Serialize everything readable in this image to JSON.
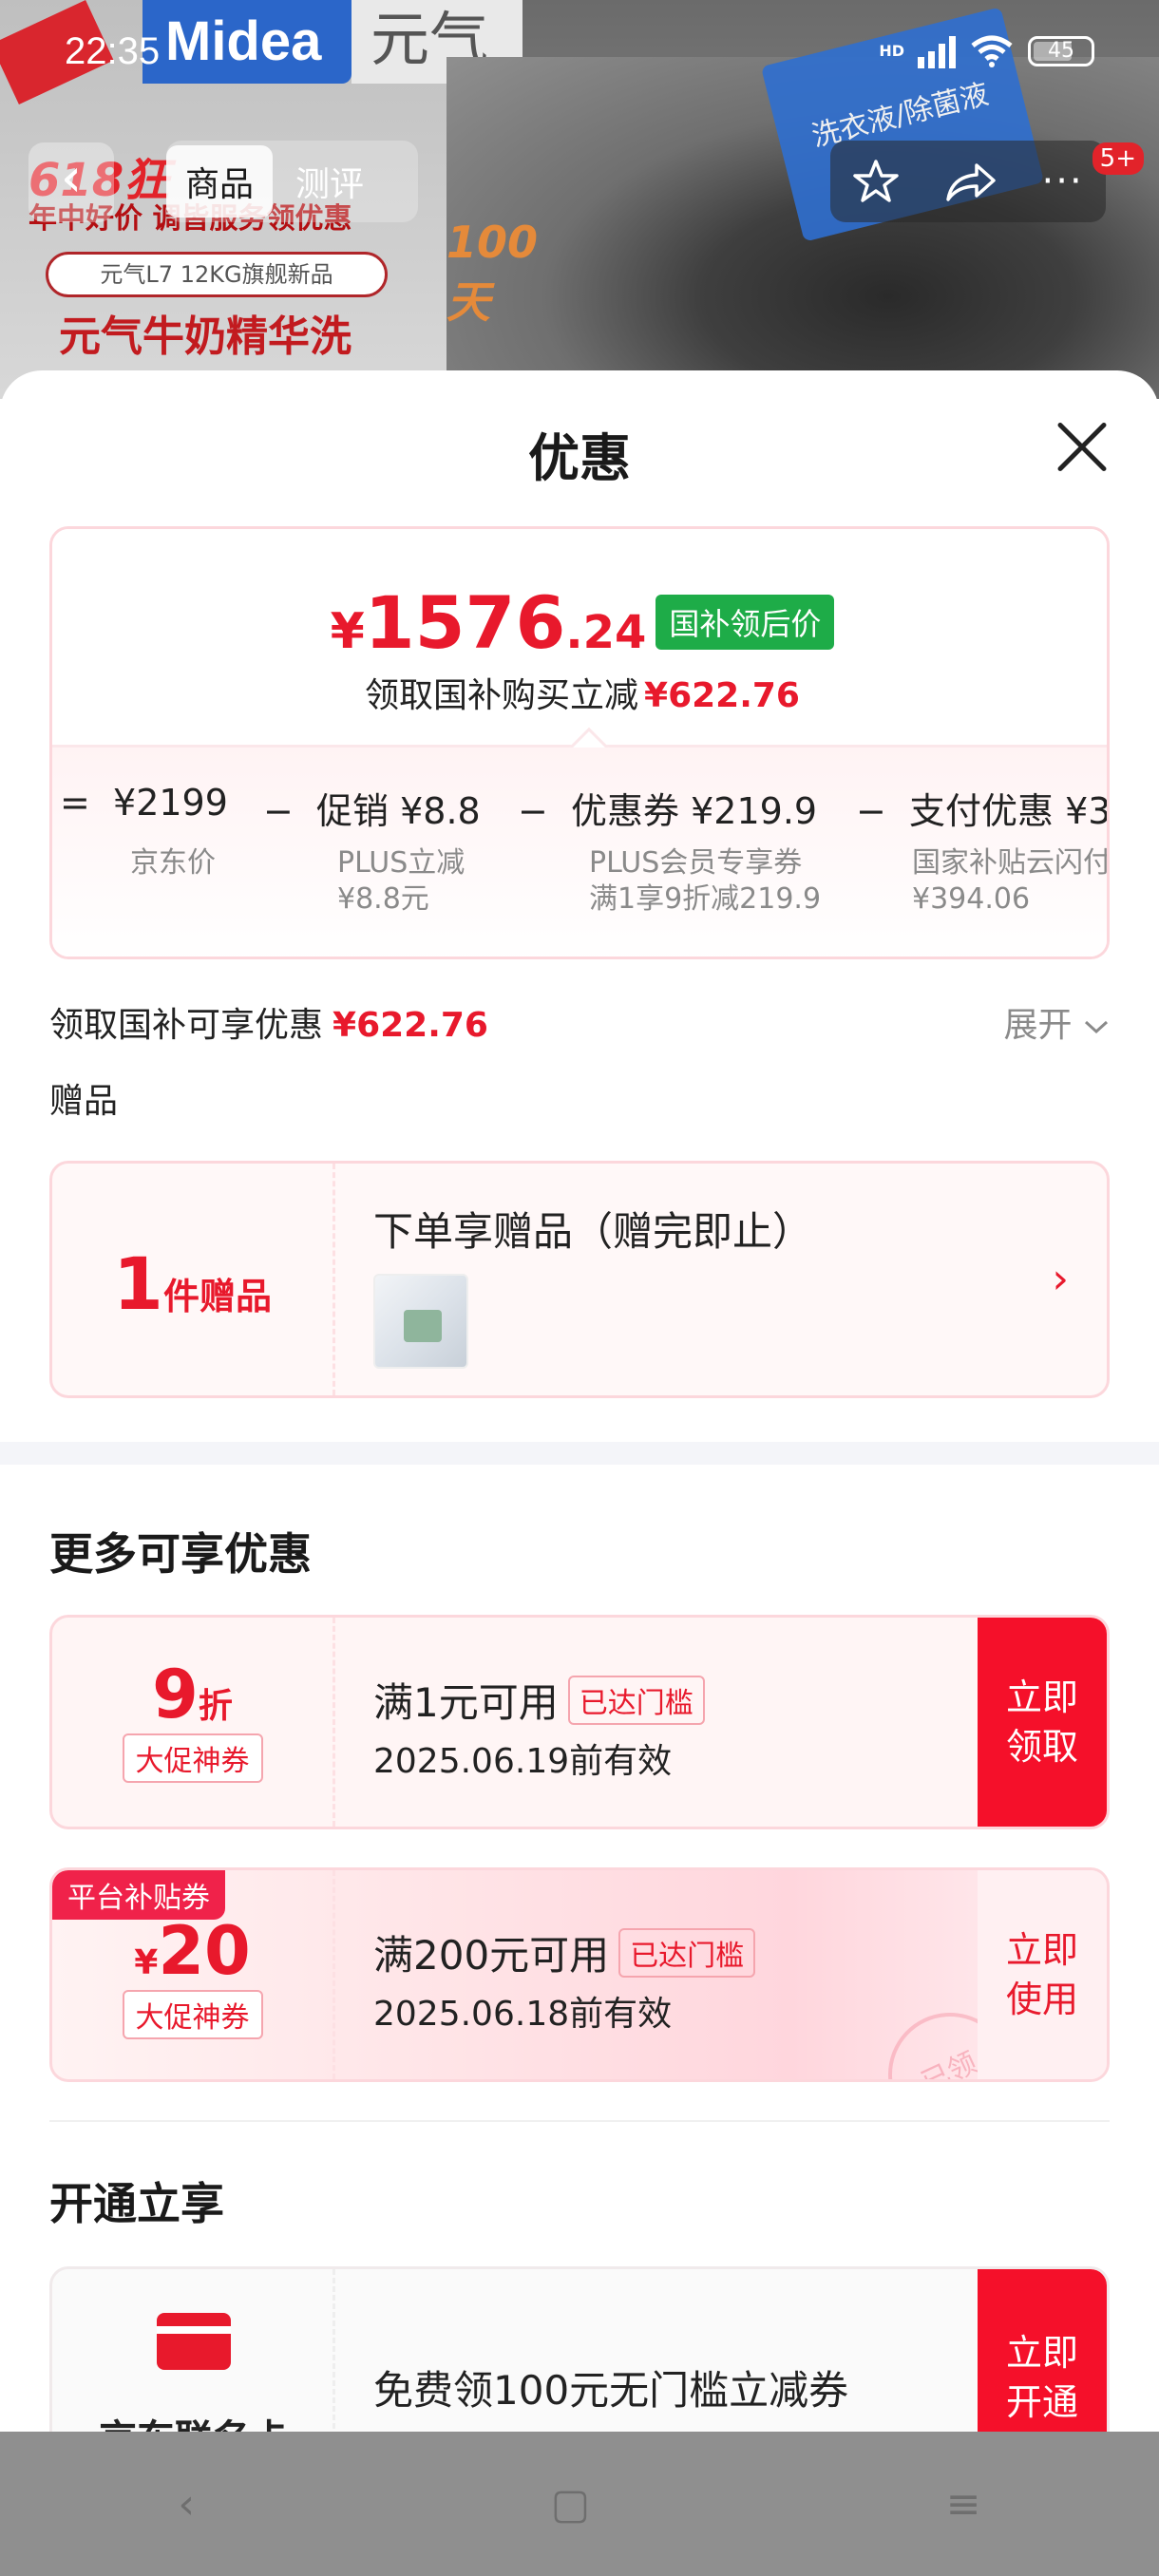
{
  "status_bar": {
    "time": "22:35",
    "network": "HD",
    "battery": "45"
  },
  "product_bg": {
    "brand": "Midea",
    "series": "元气",
    "promo_618": "618狂",
    "promo_line1": "年中好价 调皆服务领优惠",
    "model_pill": "元气L7 12KG旗舰新品",
    "slogan": "元气牛奶精华洗",
    "badge_100": "100天",
    "box_label": "洗衣液/除菌液"
  },
  "product_nav": {
    "tabs": [
      "商品",
      "测评"
    ],
    "badge": "5+"
  },
  "sheet": {
    "title": "优惠"
  },
  "price_card": {
    "yen": "¥",
    "price_int": "1576",
    "price_dec": ".24",
    "price_tag": "国补领后价",
    "sub_label": "领取国补购买立减",
    "sub_value": "¥622.76",
    "breakdown": [
      {
        "op": "=",
        "label": "",
        "value": "¥2199",
        "sub1": "京东价",
        "sub2": ""
      },
      {
        "op": "−",
        "label": "促销",
        "value": "¥8.8",
        "sub1": "PLUS立减",
        "sub2": "¥8.8元"
      },
      {
        "op": "−",
        "label": "优惠券",
        "value": "¥219.9",
        "sub1": "PLUS会员专享券",
        "sub2": "满1享9折减219.9"
      },
      {
        "op": "−",
        "label": "支付优惠",
        "value": "¥3",
        "sub1": "国家补贴云闪付",
        "sub2": "¥394.06"
      }
    ]
  },
  "savings": {
    "label": "领取国补可享优惠",
    "value": "¥622.76",
    "expand": "展开"
  },
  "gift": {
    "section_label": "赠品",
    "count": "1",
    "count_unit": "件赠品",
    "title": "下单享赠品（赠完即止）"
  },
  "more_offers": {
    "title": "更多可享优惠",
    "coupons": [
      {
        "ribbon": "",
        "prefix": "",
        "big": "9",
        "unit": "折",
        "type": "大促神券",
        "condition": "满1元可用",
        "met": "已达门槛",
        "expiry": "2025.06.19前有效",
        "button": [
          "立即",
          "领取"
        ]
      },
      {
        "ribbon": "平台补贴券",
        "prefix": "¥",
        "big": "20",
        "unit": "",
        "type": "大促神券",
        "condition": "满200元可用",
        "met": "已达门槛",
        "expiry": "2025.06.18前有效",
        "button": [
          "立即",
          "使用"
        ],
        "stamp": "已领"
      }
    ]
  },
  "join": {
    "title": "开通立享",
    "card_name": "京东联名卡",
    "text": "免费领100元无门槛立减券",
    "button": [
      "立即",
      "开通"
    ]
  },
  "system_nav": {
    "back": "‹",
    "home": "▢",
    "menu": "≡"
  }
}
